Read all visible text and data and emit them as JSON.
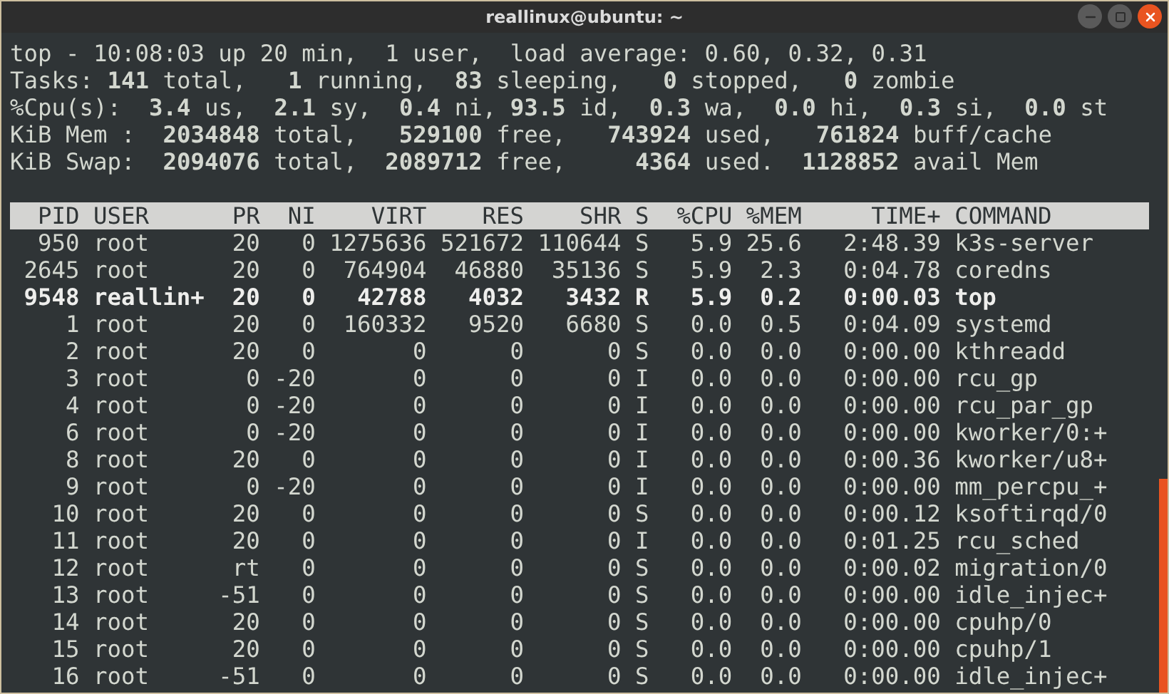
{
  "window": {
    "title": "reallinux@ubuntu: ~"
  },
  "summary": [
    "top - 10:08:03 up 20 min,  1 user,  load average: 0.60, 0.32, 0.31",
    "Tasks: **141** total,   **1** running,  **83** sleeping,   **0** stopped,   **0** zombie",
    "%Cpu(s):  **3.4** us,  **2.1** sy,  **0.4** ni, **93.5** id,  **0.3** wa,  **0.0** hi,  **0.3** si,  **0.0** st",
    "KiB Mem :  **2034848** total,   **529100** free,   **743924** used,   **761824** buff/cache",
    "KiB Swap:  **2094076** total,  **2089712** free,     **4364** used.  **1128852** avail Mem"
  ],
  "table": {
    "columns": [
      "PID",
      "USER",
      "PR",
      "NI",
      "VIRT",
      "RES",
      "SHR",
      "S",
      "%CPU",
      "%MEM",
      "TIME+",
      "COMMAND"
    ],
    "rows": [
      {
        "highlighted": false,
        "cells": [
          "950",
          "root",
          "20",
          "0",
          "1275636",
          "521672",
          "110644",
          "S",
          "5.9",
          "25.6",
          "2:48.39",
          "k3s-server"
        ]
      },
      {
        "highlighted": false,
        "cells": [
          "2645",
          "root",
          "20",
          "0",
          "764904",
          "46880",
          "35136",
          "S",
          "5.9",
          "2.3",
          "0:04.78",
          "coredns"
        ]
      },
      {
        "highlighted": true,
        "cells": [
          "9548",
          "reallin+",
          "20",
          "0",
          "42788",
          "4032",
          "3432",
          "R",
          "5.9",
          "0.2",
          "0:00.03",
          "top"
        ]
      },
      {
        "highlighted": false,
        "cells": [
          "1",
          "root",
          "20",
          "0",
          "160332",
          "9520",
          "6680",
          "S",
          "0.0",
          "0.5",
          "0:04.09",
          "systemd"
        ]
      },
      {
        "highlighted": false,
        "cells": [
          "2",
          "root",
          "20",
          "0",
          "0",
          "0",
          "0",
          "S",
          "0.0",
          "0.0",
          "0:00.00",
          "kthreadd"
        ]
      },
      {
        "highlighted": false,
        "cells": [
          "3",
          "root",
          "0",
          "-20",
          "0",
          "0",
          "0",
          "I",
          "0.0",
          "0.0",
          "0:00.00",
          "rcu_gp"
        ]
      },
      {
        "highlighted": false,
        "cells": [
          "4",
          "root",
          "0",
          "-20",
          "0",
          "0",
          "0",
          "I",
          "0.0",
          "0.0",
          "0:00.00",
          "rcu_par_gp"
        ]
      },
      {
        "highlighted": false,
        "cells": [
          "6",
          "root",
          "0",
          "-20",
          "0",
          "0",
          "0",
          "I",
          "0.0",
          "0.0",
          "0:00.00",
          "kworker/0:+"
        ]
      },
      {
        "highlighted": false,
        "cells": [
          "8",
          "root",
          "20",
          "0",
          "0",
          "0",
          "0",
          "I",
          "0.0",
          "0.0",
          "0:00.36",
          "kworker/u8+"
        ]
      },
      {
        "highlighted": false,
        "cells": [
          "9",
          "root",
          "0",
          "-20",
          "0",
          "0",
          "0",
          "I",
          "0.0",
          "0.0",
          "0:00.00",
          "mm_percpu_+"
        ]
      },
      {
        "highlighted": false,
        "cells": [
          "10",
          "root",
          "20",
          "0",
          "0",
          "0",
          "0",
          "S",
          "0.0",
          "0.0",
          "0:00.12",
          "ksoftirqd/0"
        ]
      },
      {
        "highlighted": false,
        "cells": [
          "11",
          "root",
          "20",
          "0",
          "0",
          "0",
          "0",
          "I",
          "0.0",
          "0.0",
          "0:01.25",
          "rcu_sched"
        ]
      },
      {
        "highlighted": false,
        "cells": [
          "12",
          "root",
          "rt",
          "0",
          "0",
          "0",
          "0",
          "S",
          "0.0",
          "0.0",
          "0:00.02",
          "migration/0"
        ]
      },
      {
        "highlighted": false,
        "cells": [
          "13",
          "root",
          "-51",
          "0",
          "0",
          "0",
          "0",
          "S",
          "0.0",
          "0.0",
          "0:00.00",
          "idle_injec+"
        ]
      },
      {
        "highlighted": false,
        "cells": [
          "14",
          "root",
          "20",
          "0",
          "0",
          "0",
          "0",
          "S",
          "0.0",
          "0.0",
          "0:00.00",
          "cpuhp/0"
        ]
      },
      {
        "highlighted": false,
        "cells": [
          "15",
          "root",
          "20",
          "0",
          "0",
          "0",
          "0",
          "S",
          "0.0",
          "0.0",
          "0:00.00",
          "cpuhp/1"
        ]
      },
      {
        "highlighted": false,
        "cells": [
          "16",
          "root",
          "-51",
          "0",
          "0",
          "0",
          "0",
          "S",
          "0.0",
          "0.0",
          "0:00.00",
          "idle_injec+"
        ]
      }
    ]
  }
}
